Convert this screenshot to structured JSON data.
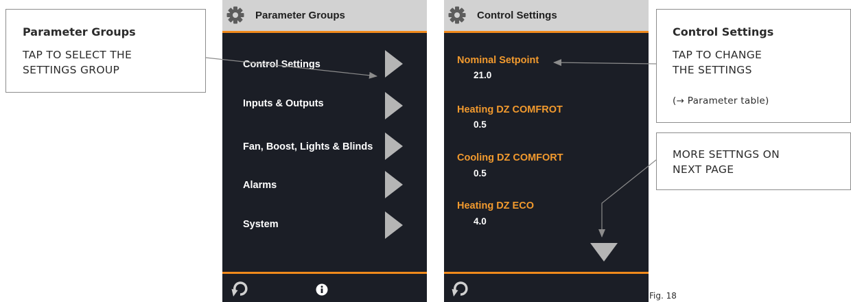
{
  "left_callout": {
    "title": "Parameter Groups",
    "text": "TAP TO SELECT THE\nSETTINGS GROUP"
  },
  "right_callout_top": {
    "title": "Control Settings",
    "text": "TAP TO CHANGE\nTHE SETTINGS",
    "note": "(→  Parameter table)"
  },
  "right_callout_bottom": {
    "text": "MORE SETTNGS ON\nNEXT PAGE"
  },
  "screen1": {
    "title": "Parameter Groups",
    "items": [
      {
        "label": "Control Settings"
      },
      {
        "label": "Inputs & Outputs"
      },
      {
        "label": "Fan, Boost, Lights & Blinds"
      },
      {
        "label": "Alarms"
      },
      {
        "label": "System"
      }
    ],
    "footer_icons": [
      "back-arrow-icon",
      "info-icon"
    ]
  },
  "screen2": {
    "title": "Control Settings",
    "params": [
      {
        "name": "Nominal Setpoint",
        "value": "21.0"
      },
      {
        "name": "Heating DZ COMFROT",
        "value": "0.5"
      },
      {
        "name": "Cooling DZ COMFORT",
        "value": "0.5"
      },
      {
        "name": "Heating DZ ECO",
        "value": "4.0"
      }
    ],
    "footer_icons": [
      "back-arrow-icon"
    ]
  },
  "caption": "Fig. 18",
  "colors": {
    "accent": "#f08a1c",
    "param_name": "#f29a2e",
    "screen_bg": "#1b1e26",
    "header_bg": "#d2d2d2",
    "arrow_gray": "#b5b5b5"
  }
}
